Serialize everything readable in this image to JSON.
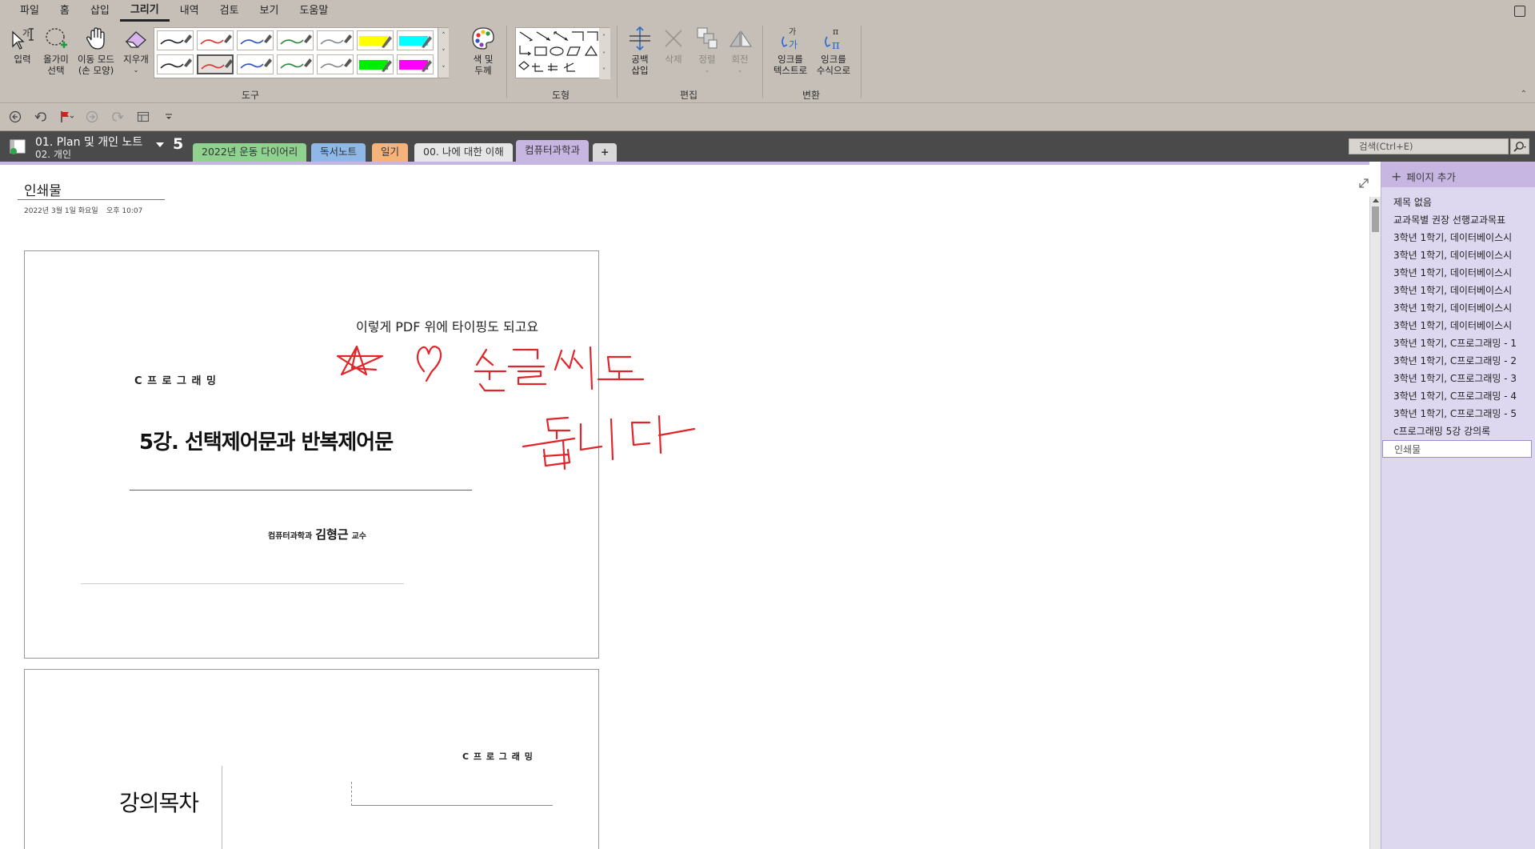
{
  "menu": [
    "파일",
    "홈",
    "삽입",
    "그리기",
    "내역",
    "검토",
    "보기",
    "도움말"
  ],
  "menu_active_index": 3,
  "ribbon": {
    "input_label": "입력",
    "lasso_label": [
      "올가미",
      "선택"
    ],
    "pan_label": [
      "이동 모드",
      "(손 모양)"
    ],
    "eraser_label": "지우개",
    "color_width_label": [
      "색 및",
      "두께"
    ],
    "group_tools": "도구",
    "group_shapes": "도형",
    "insert_space_label": [
      "공백",
      "삽입"
    ],
    "delete_label": "삭제",
    "arrange_label": "정렬",
    "rotate_label": "회전",
    "group_edit": "편집",
    "ink_to_text_label": [
      "잉크를",
      "텍스트로"
    ],
    "ink_to_math_label": [
      "잉크를",
      "수식으로"
    ],
    "group_convert": "변환",
    "pens": [
      {
        "color": "#222222",
        "type": "pen"
      },
      {
        "color": "#e03030",
        "type": "pen"
      },
      {
        "color": "#3050c8",
        "type": "pen"
      },
      {
        "color": "#2a8a3a",
        "type": "pen"
      },
      {
        "color": "#888888",
        "type": "pen"
      },
      {
        "color": "#ffff00",
        "type": "highlighter"
      },
      {
        "color": "#00ffff",
        "type": "highlighter"
      },
      {
        "color": "#222222",
        "type": "pen"
      },
      {
        "color": "#e03030",
        "type": "pen",
        "selected": true
      },
      {
        "color": "#3050c8",
        "type": "pen"
      },
      {
        "color": "#2a8a3a",
        "type": "pen"
      },
      {
        "color": "#888888",
        "type": "pen"
      },
      {
        "color": "#00ee00",
        "type": "highlighter"
      },
      {
        "color": "#ff00ff",
        "type": "highlighter"
      }
    ]
  },
  "notebook": {
    "name": "01. Plan 및 개인 노트",
    "section_group": "02. 개인",
    "back_label": "5",
    "tabs": [
      {
        "label": "2022년 운동 다이어리",
        "color": "#8fd18f"
      },
      {
        "label": "독서노트",
        "color": "#8fb8e8"
      },
      {
        "label": "일기",
        "color": "#f5b27a"
      },
      {
        "label": "00. 나에 대한 이해",
        "color": "#e6e6e6"
      },
      {
        "label": "컴퓨터과학과",
        "color": "#c8b6e2",
        "active": true
      },
      {
        "label": "+",
        "color": "#d9d9d9"
      }
    ],
    "search_placeholder": "검색(Ctrl+E)"
  },
  "page": {
    "title": "인쇄물",
    "date": "2022년 3월 1일 화요일",
    "time": "오후 10:07",
    "typed_text": "이렇게 PDF 위에 타이핑도 되고요",
    "slide1": {
      "course": "C 프 로 그 래 밍",
      "lecture_title": "5강. 선택제어문과 반복제어문",
      "dept": "컴퓨터과학과",
      "professor": "김형근",
      "prof_suffix": "교수"
    },
    "slide2": {
      "course": "C 프 로 그 래 밍",
      "toc": "강의목차"
    },
    "ink_color": "#e0262b"
  },
  "pagelist": {
    "add_label": "페이지 추가",
    "items": [
      "제목 없음",
      "교과목별 권장 선행교과목표",
      "3학년 1학기, 데이터베이스시",
      "3학년 1학기, 데이터베이스시",
      "3학년 1학기, 데이터베이스시",
      "3학년 1학기, 데이터베이스시",
      "3학년 1학기, 데이터베이스시",
      "3학년 1학기, 데이터베이스시",
      "3학년 1학기, C프로그래밍 - 1",
      "3학년 1학기, C프로그래밍 - 2",
      "3학년 1학기, C프로그래밍 - 3",
      "3학년 1학기, C프로그래밍 - 4",
      "3학년 1학기, C프로그래밍 - 5",
      "c프로그래밍 5강 강의록",
      "인쇄물"
    ],
    "selected_index": 14
  }
}
